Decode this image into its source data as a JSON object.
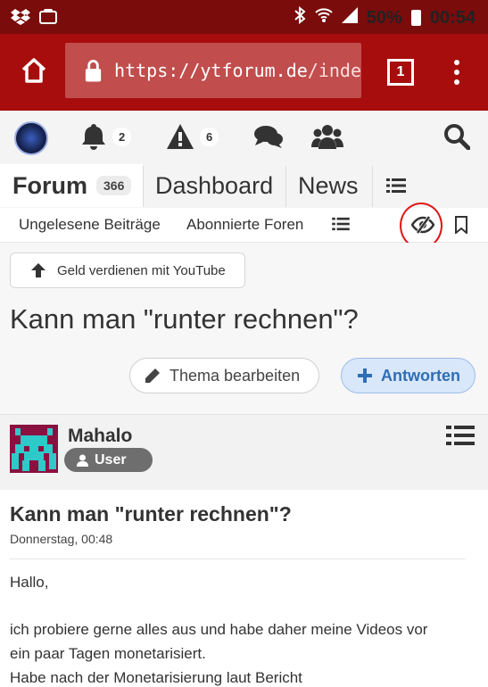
{
  "status_bar": {
    "battery": "50%",
    "time": "00:54"
  },
  "browser": {
    "url_host": "https://ytforum.de",
    "url_path": "/inde",
    "tab_count": "1"
  },
  "forum_nav": {
    "notifications_count": "2",
    "alerts_count": "6"
  },
  "tabs": {
    "forum": "Forum",
    "forum_count": "366",
    "dashboard": "Dashboard",
    "news": "News"
  },
  "subnav": {
    "unread": "Ungelesene Beiträge",
    "subscribed": "Abonnierte Foren"
  },
  "breadcrumb": "Geld verdienen mit YouTube",
  "thread": {
    "title": "Kann man \"runter rechnen\"?",
    "edit_label": "Thema bearbeiten",
    "reply_label": "Antworten"
  },
  "author": {
    "name": "Mahalo",
    "role": "User"
  },
  "post": {
    "title": "Kann man \"runter rechnen\"?",
    "date": "Donnerstag, 00:48",
    "lines": [
      "Hallo,",
      "ich probiere gerne alles aus und habe daher meine Videos vor",
      "ein paar Tagen monetarisiert.",
      "Habe nach der Monetarisierung laut Bericht"
    ]
  },
  "colors": {
    "status_bar": "#7a0c0c",
    "toolbar": "#a70d0d",
    "reply_blue": "#2f6db5",
    "highlight_circle": "#e01515"
  }
}
